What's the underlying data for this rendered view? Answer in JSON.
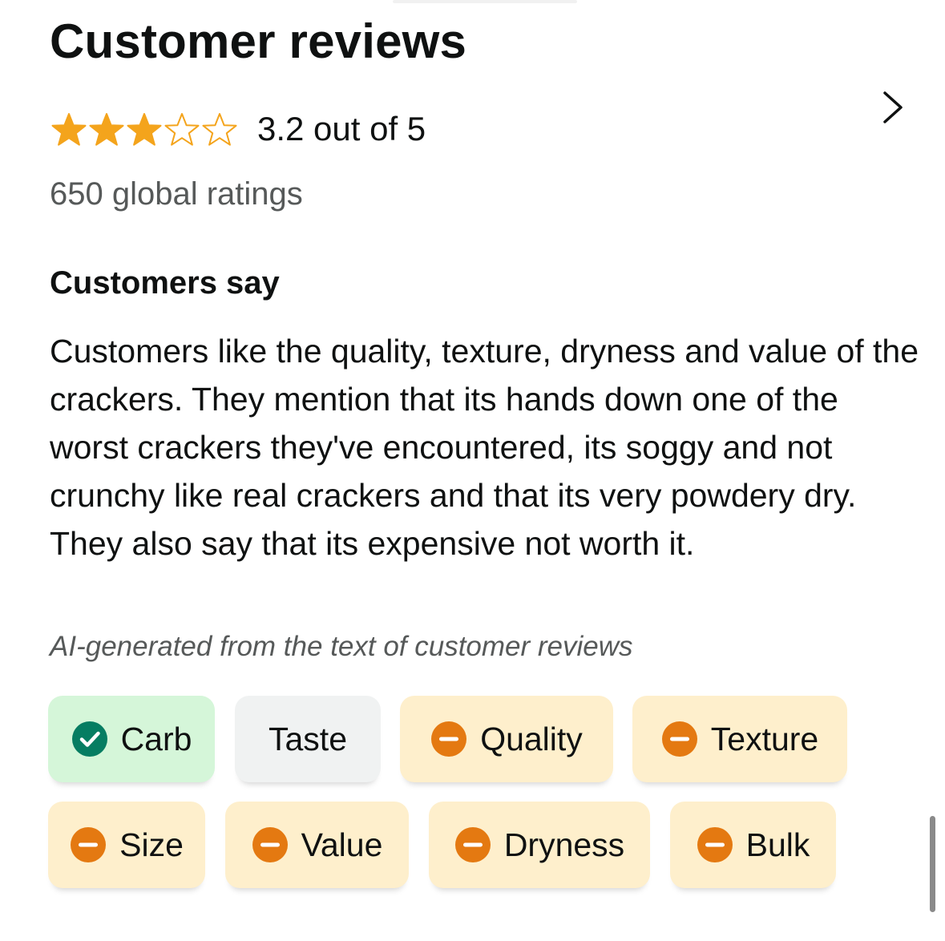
{
  "title": "Customer reviews",
  "rating": {
    "value": 3.2,
    "max": 5,
    "stars_filled": 3,
    "text": "3.2 out of 5",
    "star_color": "#f4a41c"
  },
  "global_ratings": "650 global ratings",
  "customers_say": {
    "heading": "Customers say",
    "summary": "Customers like the quality, texture, dryness and value of the crackers. They mention that its hands down one of the worst crackers they've encountered, its soggy and not crunchy like real crackers and that its very powdery dry. They also say that its expensive not worth it.",
    "disclaimer": "AI-generated from the text of customer reviews"
  },
  "aspects": [
    {
      "label": "Carb",
      "sentiment": "positive",
      "icon": "check-circle-icon"
    },
    {
      "label": "Taste",
      "sentiment": "neutral",
      "icon": ""
    },
    {
      "label": "Quality",
      "sentiment": "negative",
      "icon": "minus-circle-icon"
    },
    {
      "label": "Texture",
      "sentiment": "negative",
      "icon": "minus-circle-icon"
    },
    {
      "label": "Size",
      "sentiment": "negative",
      "icon": "minus-circle-icon"
    },
    {
      "label": "Value",
      "sentiment": "negative",
      "icon": "minus-circle-icon"
    },
    {
      "label": "Dryness",
      "sentiment": "negative",
      "icon": "minus-circle-icon"
    },
    {
      "label": "Bulk",
      "sentiment": "negative",
      "icon": "minus-circle-icon"
    }
  ],
  "colors": {
    "positive_bg": "#d5f6d9",
    "positive_icon": "#067d62",
    "neutral_bg": "#f0f2f2",
    "negative_bg": "#feefcc",
    "negative_icon": "#e47911"
  }
}
